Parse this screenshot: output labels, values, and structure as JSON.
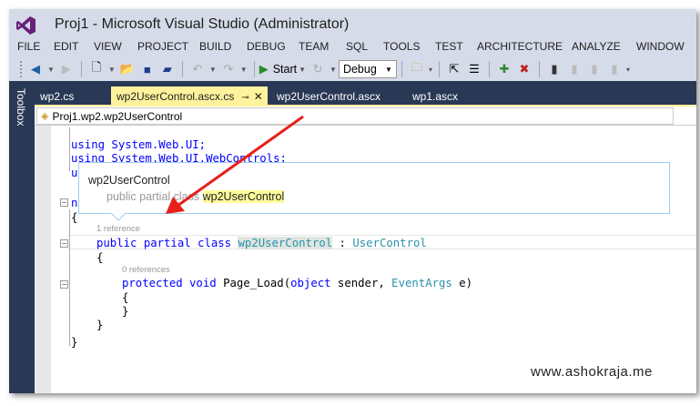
{
  "window": {
    "title": "Proj1 - Microsoft Visual Studio (Administrator)"
  },
  "menu": [
    "FILE",
    "EDIT",
    "VIEW",
    "PROJECT",
    "BUILD",
    "DEBUG",
    "TEAM",
    "SQL",
    "TOOLS",
    "TEST",
    "ARCHITECTURE",
    "ANALYZE",
    "WINDOW"
  ],
  "toolbar": {
    "start_label": "Start",
    "config_value": "Debug"
  },
  "toolbox_label": "Toolbox",
  "tabs": [
    {
      "label": "wp2.cs"
    },
    {
      "label": "wp2UserControl.ascx.cs",
      "active": true
    },
    {
      "label": "wp2UserControl.ascx"
    },
    {
      "label": "wp1.ascx"
    }
  ],
  "navbar": {
    "scope": "Proj1.wp2.wp2UserControl"
  },
  "code": {
    "l1": "using System.Web.UI;",
    "l2": "using System.Web.UI.WebControls;",
    "l3": "u",
    "l4": "n",
    "brace_open": "{",
    "brace_close": "}",
    "lens1": "1 reference",
    "class_kw": "public partial class ",
    "class_name": "wp2UserControl",
    "class_sep": " : ",
    "class_base": "UserControl",
    "lens2": "0 references",
    "method_kw": "protected void ",
    "method_name": "Page_Load(",
    "method_obj": "object",
    "method_mid": " sender, ",
    "method_type": "EventArgs",
    "method_end": " e)"
  },
  "tooltip": {
    "title": "wp2UserControl",
    "sig_prefix": "public partial class ",
    "sig_name": "wp2UserControl"
  },
  "watermark": "www.ashokraja.me",
  "colors": {
    "chrome": "#d6dbe9",
    "tabstrip": "#293955",
    "active_tab": "#fff29d",
    "keyword": "#0000ff",
    "type": "#2b91af",
    "arrow": "#e8201a"
  }
}
